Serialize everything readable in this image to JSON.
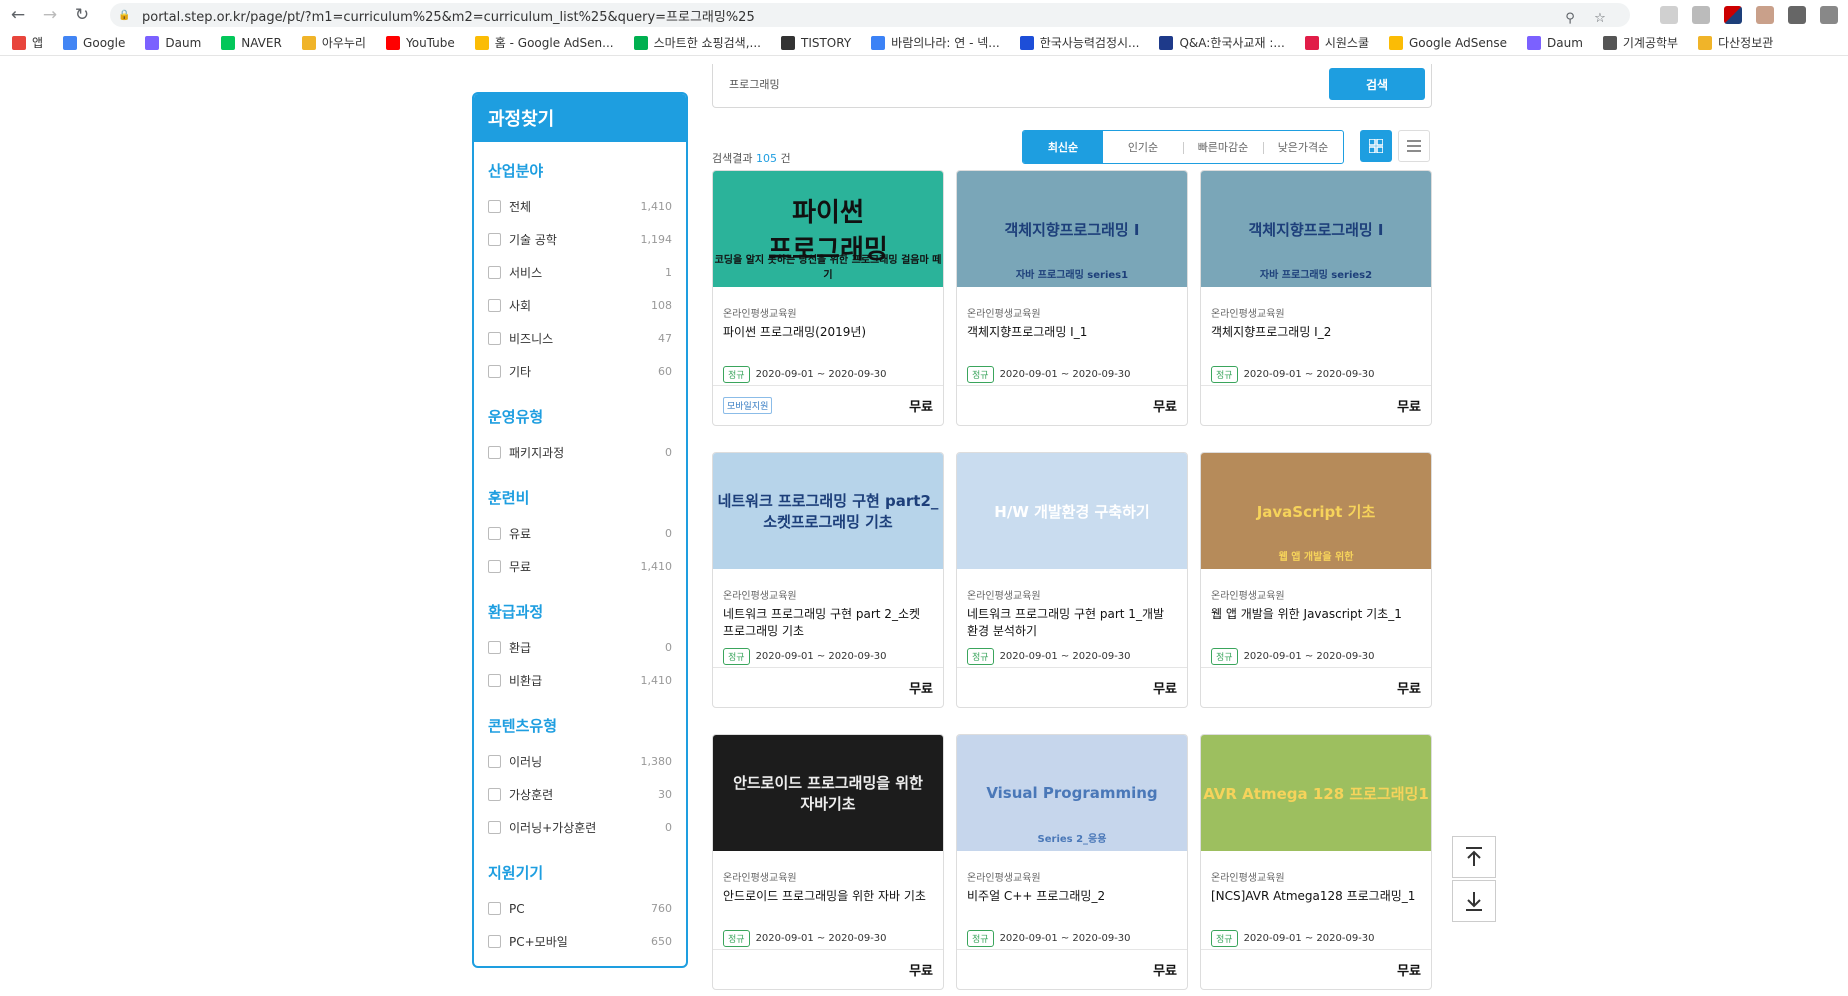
{
  "browser": {
    "url": "portal.step.or.kr/page/pt/?m1=curriculum%25&m2=curriculum_list%25&query=프로그래밍%25",
    "bookmarks": [
      {
        "label": "앱",
        "color": "#e8453c"
      },
      {
        "label": "Google",
        "color": "#4285f4"
      },
      {
        "label": "Daum",
        "color": "#7b61ff"
      },
      {
        "label": "NAVER",
        "color": "#03c75a"
      },
      {
        "label": "아우누리",
        "color": "#f0b429"
      },
      {
        "label": "YouTube",
        "color": "#ff0000"
      },
      {
        "label": "홈 - Google AdSen...",
        "color": "#fbbc05"
      },
      {
        "label": "스마트한 쇼핑검색,...",
        "color": "#00b050"
      },
      {
        "label": "TISTORY",
        "color": "#333333"
      },
      {
        "label": "바람의나라: 연 - 넥...",
        "color": "#3b82f6"
      },
      {
        "label": "한국사능력검정시...",
        "color": "#1d4ed8"
      },
      {
        "label": "Q&A:한국사교재 :...",
        "color": "#1e3a8a"
      },
      {
        "label": "시원스쿨",
        "color": "#e11d48"
      },
      {
        "label": "Google AdSense",
        "color": "#fbbc05"
      },
      {
        "label": "Daum",
        "color": "#7b61ff"
      },
      {
        "label": "기계공학부",
        "color": "#555555"
      },
      {
        "label": "다산정보관",
        "color": "#f0b429"
      }
    ]
  },
  "sidebar": {
    "title": "과정찾기",
    "sections": [
      {
        "title": "산업분야",
        "items": [
          {
            "label": "전체",
            "count": "1,410"
          },
          {
            "label": "기술 공학",
            "count": "1,194"
          },
          {
            "label": "서비스",
            "count": "1"
          },
          {
            "label": "사회",
            "count": "108"
          },
          {
            "label": "비즈니스",
            "count": "47"
          },
          {
            "label": "기타",
            "count": "60"
          }
        ]
      },
      {
        "title": "운영유형",
        "items": [
          {
            "label": "패키지과정",
            "count": "0"
          }
        ]
      },
      {
        "title": "훈련비",
        "items": [
          {
            "label": "유료",
            "count": "0"
          },
          {
            "label": "무료",
            "count": "1,410"
          }
        ]
      },
      {
        "title": "환급과정",
        "items": [
          {
            "label": "환급",
            "count": "0"
          },
          {
            "label": "비환급",
            "count": "1,410"
          }
        ]
      },
      {
        "title": "콘텐츠유형",
        "items": [
          {
            "label": "이러닝",
            "count": "1,380"
          },
          {
            "label": "가상훈련",
            "count": "30"
          },
          {
            "label": "이러닝+가상훈련",
            "count": "0"
          }
        ]
      },
      {
        "title": "지원기기",
        "items": [
          {
            "label": "PC",
            "count": "760"
          },
          {
            "label": "PC+모바일",
            "count": "650"
          }
        ]
      }
    ]
  },
  "search": {
    "value": "프로그래밍",
    "button": "검색"
  },
  "sort_tabs": [
    "최신순",
    "인기순",
    "빠른마감순",
    "낮은가격순"
  ],
  "results": {
    "prefix": "검색결과",
    "count": "105",
    "suffix": "건"
  },
  "cards": [
    {
      "org": "온라인평생교육원",
      "title": "파이썬 프로그래밍(2019년)",
      "badge": "정규",
      "date": "2020-09-01 ~ 2020-09-30",
      "price": "무료",
      "mobile": "모바일지원",
      "thumb_text": "파이썬\n프로그래밍",
      "thumb_sub": "코딩을 알지 못하는 당신을 위한 프로그래밍 걸음마 떼기",
      "bg": "#2bb39a",
      "fg": "#111111"
    },
    {
      "org": "온라인평생교육원",
      "title": "객체지향프로그래밍 I_1",
      "badge": "정규",
      "date": "2020-09-01 ~ 2020-09-30",
      "price": "무료",
      "mobile": "",
      "thumb_text": "객체지향프로그래밍 I",
      "thumb_sub": "자바 프로그래밍 series1",
      "bg": "#7aa6b8",
      "fg": "#1d3f7a"
    },
    {
      "org": "온라인평생교육원",
      "title": "객체지향프로그래밍 I_2",
      "badge": "정규",
      "date": "2020-09-01 ~ 2020-09-30",
      "price": "무료",
      "mobile": "",
      "thumb_text": "객체지향프로그래밍 I",
      "thumb_sub": "자바 프로그래밍 series2",
      "bg": "#7aa6b8",
      "fg": "#1d3f7a"
    },
    {
      "org": "온라인평생교육원",
      "title": "네트워크 프로그래밍 구현 part 2_소켓 프로그래밍 기초",
      "badge": "정규",
      "date": "2020-09-01 ~ 2020-09-30",
      "price": "무료",
      "mobile": "",
      "thumb_text": "네트워크 프로그래밍 구현 part2_소켓프로그래밍 기초",
      "thumb_sub": "",
      "bg": "#b7d4ea",
      "fg": "#1d3f7a"
    },
    {
      "org": "온라인평생교육원",
      "title": "네트워크 프로그래밍 구현 part 1_개발 환경 분석하기",
      "badge": "정규",
      "date": "2020-09-01 ~ 2020-09-30",
      "price": "무료",
      "mobile": "",
      "thumb_text": "H/W 개발환경 구축하기",
      "thumb_sub": "",
      "bg": "#c9dcef",
      "fg": "#ffffff"
    },
    {
      "org": "온라인평생교육원",
      "title": "웹 앱 개발을 위한 Javascript 기초_1",
      "badge": "정규",
      "date": "2020-09-01 ~ 2020-09-30",
      "price": "무료",
      "mobile": "",
      "thumb_text": "JavaScript 기초",
      "thumb_sub": "웹 앱 개발을 위한",
      "bg": "#b68b5a",
      "fg": "#f6d35b"
    },
    {
      "org": "온라인평생교육원",
      "title": "안드로이드 프로그래밍을 위한 자바 기초",
      "badge": "정규",
      "date": "2020-09-01 ~ 2020-09-30",
      "price": "무료",
      "mobile": "",
      "thumb_text": "안드로이드 프로그래밍을 위한\n자바기초",
      "thumb_sub": "",
      "bg": "#1c1c1c",
      "fg": "#eeeeee"
    },
    {
      "org": "온라인평생교육원",
      "title": "비주얼 C++ 프로그래밍_2",
      "badge": "정규",
      "date": "2020-09-01 ~ 2020-09-30",
      "price": "무료",
      "mobile": "",
      "thumb_text": "Visual Programming",
      "thumb_sub": "Series 2_응용",
      "bg": "#c6d6ec",
      "fg": "#4a78b8"
    },
    {
      "org": "온라인평생교육원",
      "title": "[NCS]AVR Atmega128 프로그래밍_1",
      "badge": "정규",
      "date": "2020-09-01 ~ 2020-09-30",
      "price": "무료",
      "mobile": "",
      "thumb_text": "AVR Atmega 128 프로그래밍1",
      "thumb_sub": "",
      "bg": "#9dbf5f",
      "fg": "#f6d35b"
    }
  ],
  "colors": {
    "accent": "#1e9ee0",
    "badge_green": "#3aa55c"
  }
}
